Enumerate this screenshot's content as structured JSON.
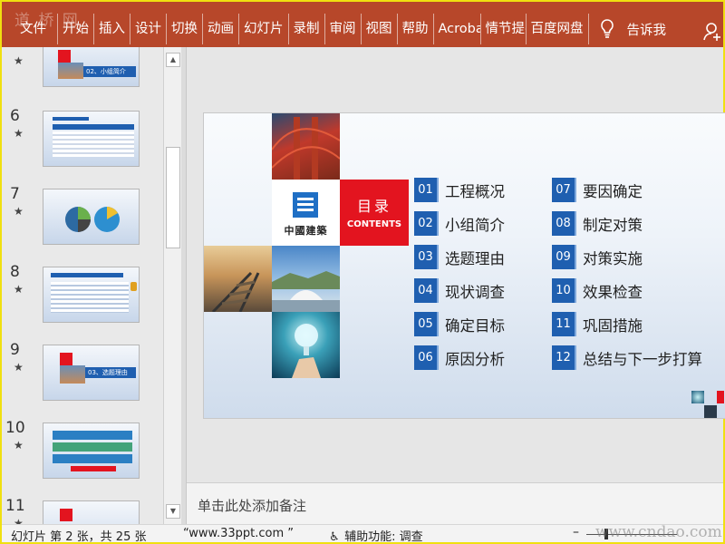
{
  "ribbon": {
    "tabs": [
      "文件",
      "开始",
      "插入",
      "设计",
      "切换",
      "动画",
      "幻灯片",
      "录制",
      "审阅",
      "视图",
      "帮助",
      "Acrobat",
      "情节提要",
      "百度网盘"
    ],
    "tell_me": "告诉我",
    "watermark": "道 桥 网"
  },
  "thumbnails": [
    {
      "number": "",
      "caption": "02、小组简介"
    },
    {
      "number": "6",
      "caption": ""
    },
    {
      "number": "7",
      "caption": ""
    },
    {
      "number": "8",
      "caption": ""
    },
    {
      "number": "9",
      "caption": "03、选题理由"
    },
    {
      "number": "10",
      "caption": ""
    },
    {
      "number": "11",
      "caption": ""
    }
  ],
  "star": "★",
  "slide": {
    "company": "中國建築",
    "toc_title_cn": "目录",
    "toc_title_en": "CONTENTS",
    "items_left": [
      {
        "num": "01",
        "label": "工程概况"
      },
      {
        "num": "02",
        "label": "小组简介"
      },
      {
        "num": "03",
        "label": "选题理由"
      },
      {
        "num": "04",
        "label": "现状调查"
      },
      {
        "num": "05",
        "label": "确定目标"
      },
      {
        "num": "06",
        "label": "原因分析"
      }
    ],
    "items_right": [
      {
        "num": "07",
        "label": "要因确定"
      },
      {
        "num": "08",
        "label": "制定对策"
      },
      {
        "num": "09",
        "label": "对策实施"
      },
      {
        "num": "10",
        "label": "效果检查"
      },
      {
        "num": "11",
        "label": "巩固措施"
      },
      {
        "num": "12",
        "label": "总结与下一步打算"
      }
    ],
    "colors": {
      "accent": "#e3141f",
      "number_box": "#1f5fb0"
    }
  },
  "notes_placeholder": "单击此处添加备注",
  "status": {
    "slide_info": "幻灯片 第 2 张，共 25 张",
    "theme": "“www.33ppt.com ”",
    "accessibility": "辅助功能: 调查",
    "zoom_minus": "–",
    "site_watermark": "www.cndao.com"
  }
}
